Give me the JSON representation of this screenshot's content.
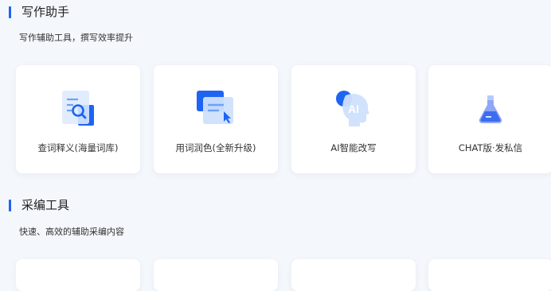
{
  "sections": [
    {
      "title": "写作助手",
      "subtitle": "写作辅助工具，撰写效率提升",
      "cards": [
        {
          "label": "查词释义(海量词库)",
          "icon": "search-document-icon"
        },
        {
          "label": "用词润色(全新升级)",
          "icon": "polish-document-icon"
        },
        {
          "label": "AI智能改写",
          "icon": "ai-head-icon"
        },
        {
          "label": "CHAT版·发私信",
          "icon": "chat-flask-icon"
        }
      ]
    },
    {
      "title": "采编工具",
      "subtitle": "快速、高效的辅助采编内容"
    }
  ],
  "colors": {
    "accent": "#1d64f2",
    "background": "#f4f7fb",
    "card": "#ffffff"
  }
}
